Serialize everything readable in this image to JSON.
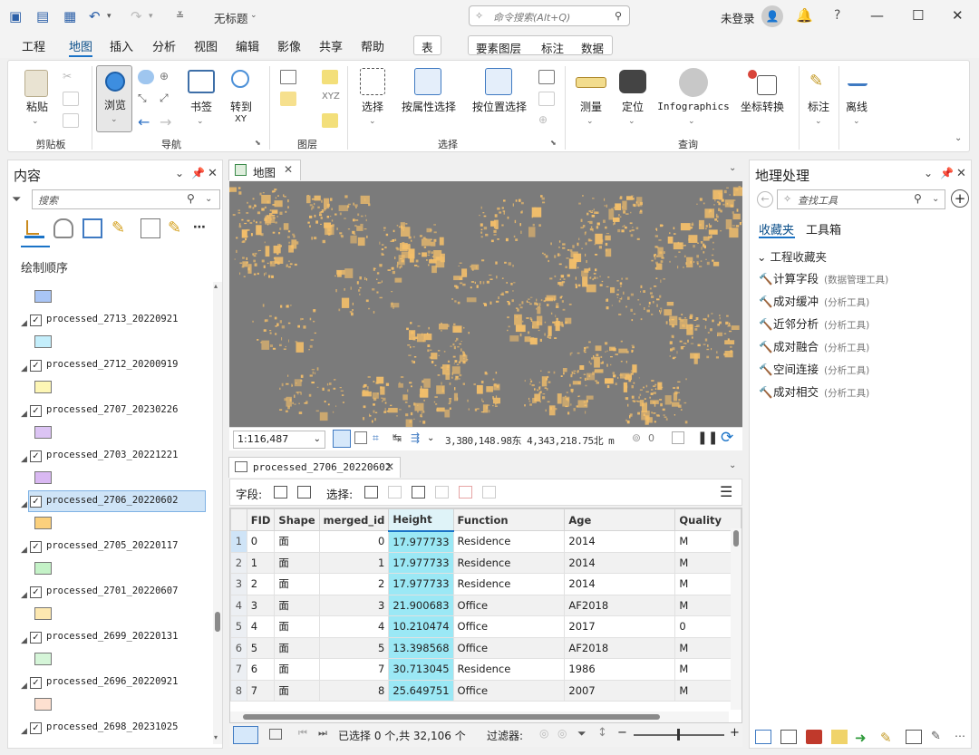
{
  "window": {
    "doc_title": "无标题",
    "command_search_placeholder": "命令搜索(Alt+Q)",
    "user_status": "未登录",
    "help_label": "?"
  },
  "menu": {
    "items": [
      "工程",
      "地图",
      "插入",
      "分析",
      "视图",
      "编辑",
      "影像",
      "共享",
      "帮助"
    ],
    "context_tabs": [
      "表",
      "要素图层",
      "标注",
      "数据"
    ]
  },
  "ribbon": {
    "paste": "粘贴",
    "browse": "浏览",
    "bookmarks": "书签",
    "goto_xy_1": "转到",
    "goto_xy_2": "XY",
    "select": "选择",
    "select_by_attr": "按属性选择",
    "select_by_loc": "按位置选择",
    "measure": "测量",
    "locate": "定位",
    "infographics": "Infographics",
    "coord_convert": "坐标转换",
    "label": "标注",
    "offline": "离线",
    "groups": {
      "clipboard": "剪贴板",
      "navigate": "导航",
      "layer": "图层",
      "selection": "选择",
      "inquiry": "查询"
    }
  },
  "contents": {
    "title": "内容",
    "search_placeholder": "搜索",
    "draw_order": "绘制顺序",
    "layers": [
      {
        "name": "",
        "color": "#a9c5f5",
        "checked": false
      },
      {
        "name": "processed_2713_20220921",
        "color": "#c4eefb",
        "checked": true
      },
      {
        "name": "processed_2712_20200919",
        "color": "#fdf6b5",
        "checked": true
      },
      {
        "name": "processed_2707_20230226",
        "color": "#dcc4f4",
        "checked": true
      },
      {
        "name": "processed_2703_20221221",
        "color": "#d9b8f2",
        "checked": true
      },
      {
        "name": "processed_2706_20220602",
        "color": "#fbd07c",
        "checked": true
      },
      {
        "name": "processed_2705_20220117",
        "color": "#c4f2c7",
        "checked": true
      },
      {
        "name": "processed_2701_20220607",
        "color": "#fde8b0",
        "checked": true
      },
      {
        "name": "processed_2699_20220131",
        "color": "#d5f5d8",
        "checked": true
      },
      {
        "name": "processed_2696_20220921",
        "color": "#fde0d0",
        "checked": true
      },
      {
        "name": "processed_2698_20231025",
        "color": "#cfe0fa",
        "checked": true
      }
    ]
  },
  "map": {
    "tab": "地图",
    "scale": "1:116,487",
    "coords": "3,380,148.98东 4,343,218.75北 m",
    "selected_count": "0"
  },
  "table": {
    "tab": "processed_2706_20220602",
    "fields_label": "字段:",
    "select_label": "选择:",
    "columns": [
      "",
      "FID",
      "Shape",
      "merged_id",
      "Height",
      "Function",
      "Age",
      "Quality"
    ],
    "rows": [
      [
        "1",
        "0",
        "面",
        "0",
        "17.977733",
        "Residence",
        "2014",
        "M"
      ],
      [
        "2",
        "1",
        "面",
        "1",
        "17.977733",
        "Residence",
        "2014",
        "M"
      ],
      [
        "3",
        "2",
        "面",
        "2",
        "17.977733",
        "Residence",
        "2014",
        "M"
      ],
      [
        "4",
        "3",
        "面",
        "3",
        "21.900683",
        "Office",
        "AF2018",
        "M"
      ],
      [
        "5",
        "4",
        "面",
        "4",
        "10.210474",
        "Office",
        "2017",
        "0"
      ],
      [
        "6",
        "5",
        "面",
        "5",
        "13.398568",
        "Office",
        "AF2018",
        "M"
      ],
      [
        "7",
        "6",
        "面",
        "7",
        "30.713045",
        "Residence",
        "1986",
        "M"
      ],
      [
        "8",
        "7",
        "面",
        "8",
        "25.649751",
        "Office",
        "2007",
        "M"
      ]
    ],
    "status": "已选择 0 个,共 32,106 个",
    "filter_label": "过滤器:"
  },
  "geoprocessing": {
    "title": "地理处理",
    "search_placeholder": "查找工具",
    "tabs": [
      "收藏夹",
      "工具箱"
    ],
    "section": "工程收藏夹",
    "tools": [
      {
        "name": "计算字段",
        "toolbox": "(数据管理工具)"
      },
      {
        "name": "成对缓冲",
        "toolbox": "(分析工具)"
      },
      {
        "name": "近邻分析",
        "toolbox": "(分析工具)"
      },
      {
        "name": "成对融合",
        "toolbox": "(分析工具)"
      },
      {
        "name": "空间连接",
        "toolbox": "(分析工具)"
      },
      {
        "name": "成对相交",
        "toolbox": "(分析工具)"
      }
    ]
  },
  "colors": {
    "accent": "#1a73c7",
    "building": "#f4bf6a",
    "map_bg": "#7b7b7b",
    "height_col": "#9be8f5"
  }
}
